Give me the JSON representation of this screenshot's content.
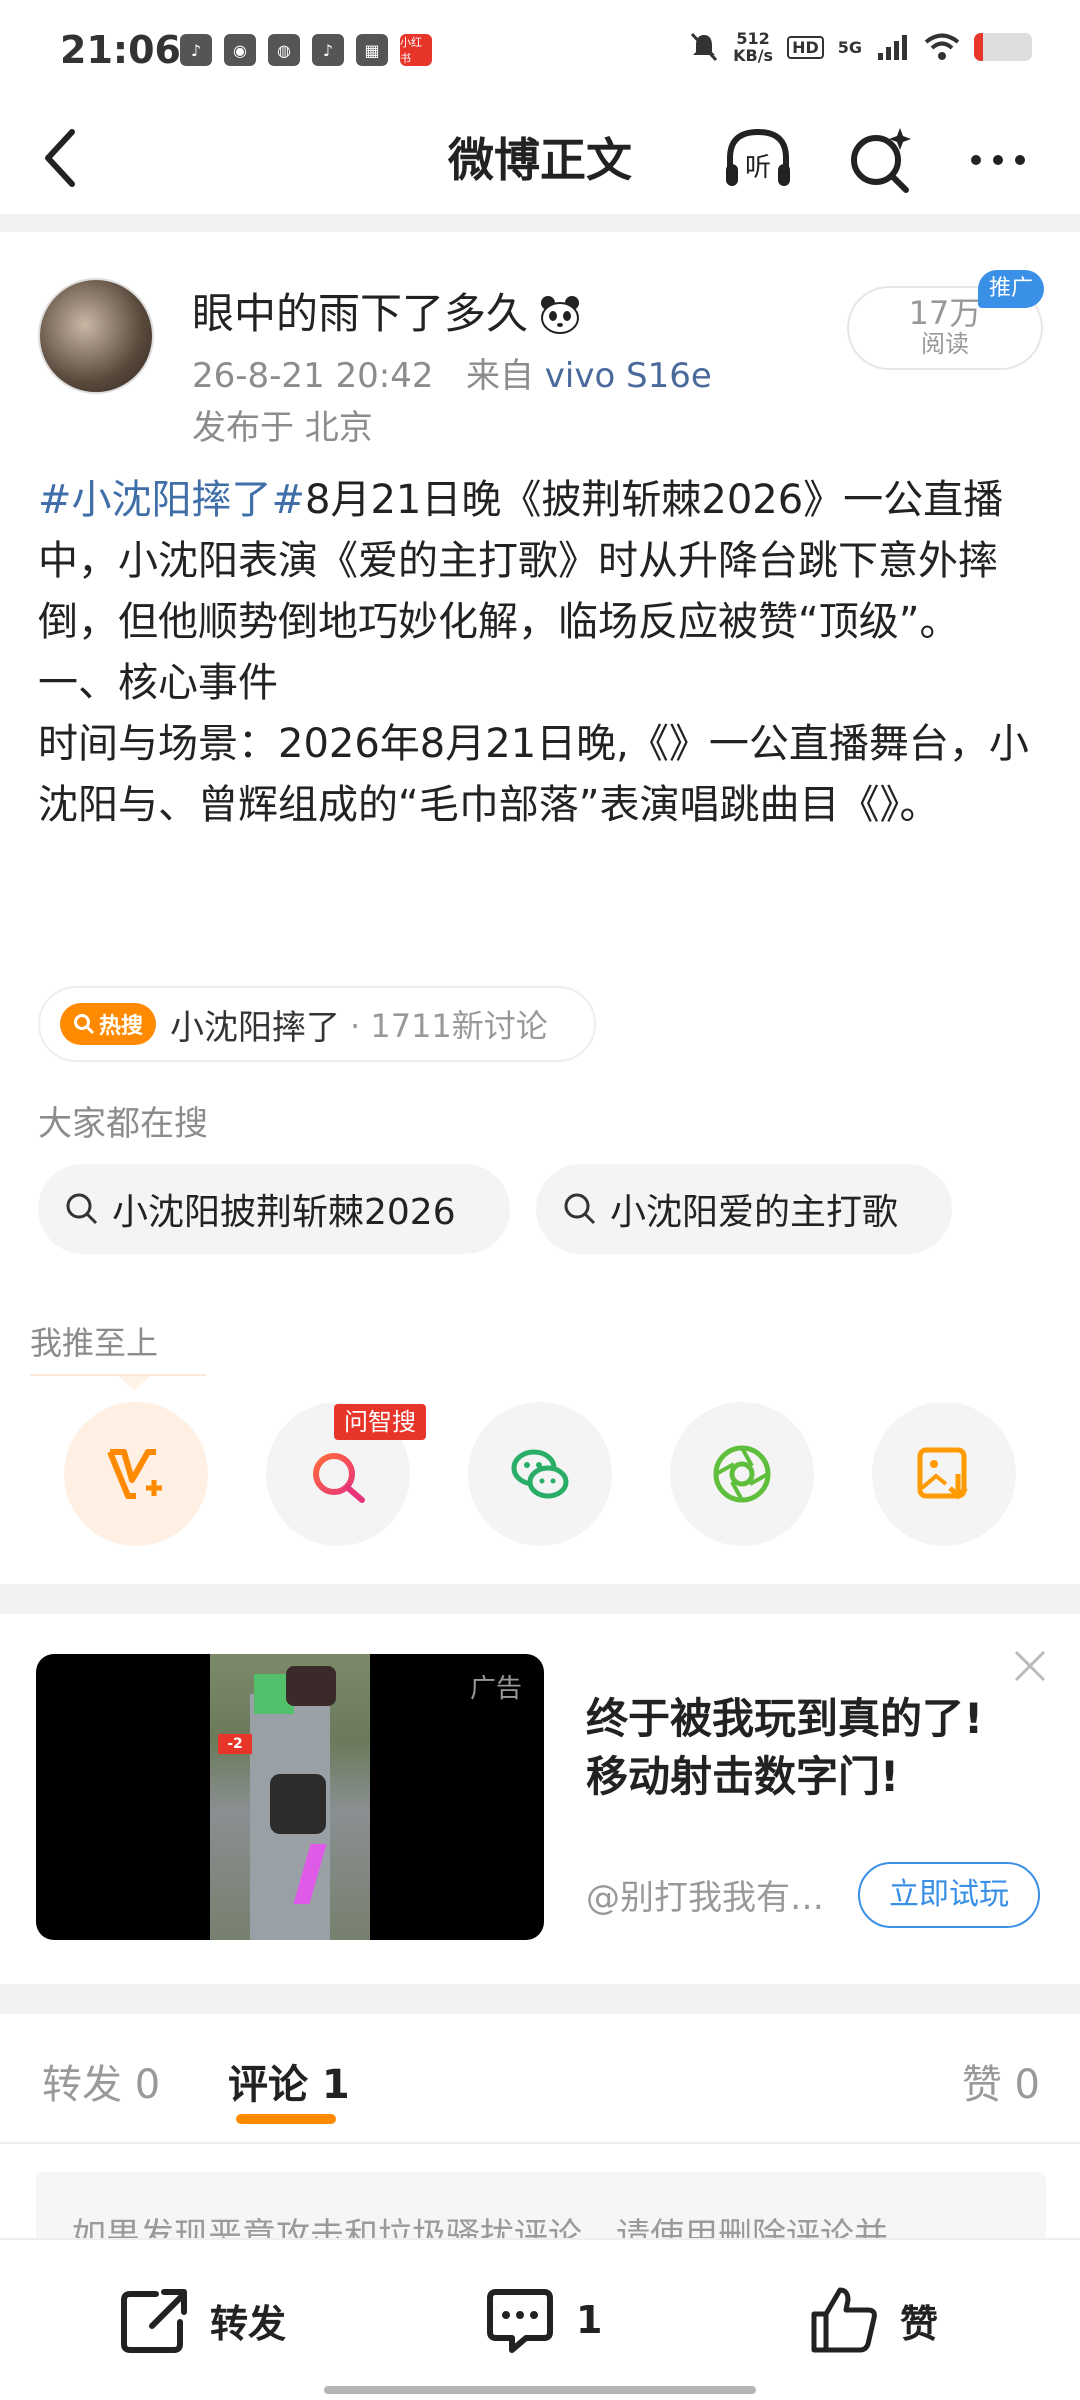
{
  "status_bar": {
    "time": "21:06",
    "app_icons": [
      "douyin-icon",
      "weibo-icon",
      "wechat-icon",
      "douyin-icon",
      "game-icon",
      "xiaohongshu-icon"
    ],
    "xiaohongshu_label": "小红书",
    "net_speed_value": "512",
    "net_speed_unit": "KB/s",
    "hd": "HD",
    "signal": "5G",
    "battery_level": 0.15,
    "battery_color": "#e8352a"
  },
  "nav": {
    "title": "微博正文",
    "listen_label": "听"
  },
  "author": {
    "name": "眼中的雨下了多久",
    "time": "26-8-21 20:42",
    "from_prefix": "来自",
    "device": "vivo S16e",
    "location": "发布于 北京",
    "read_count": "17万",
    "read_label": "阅读",
    "promo": "推广"
  },
  "post": {
    "hashtag": "#小沈阳摔了#",
    "paragraph1": "8月21日晚《披荆斩棘2026》一公直播中，小沈阳表演《爱的主打歌》时从升降台跳下意外摔倒，但他顺势倒地巧妙化解，临场反应被赞“顶级”。",
    "paragraph2": "一、核心事件",
    "paragraph3": "时间与场景：2026年8月21日晚,《》一公直播舞台，小沈阳与、曾辉组成的“毛巾部落”表演唱跳曲目《》。"
  },
  "hot_search": {
    "badge": "热搜",
    "topic": "小沈阳摔了",
    "count": "· 1711新讨论"
  },
  "search_suggest": {
    "title": "大家都在搜",
    "items": [
      "小沈阳披荆斩棘2026",
      "小沈阳爱的主打歌"
    ]
  },
  "share": {
    "title": "我推至上",
    "ask_badge": "问智搜",
    "targets": [
      "v-plus-icon",
      "ask-search-icon",
      "wechat-icon",
      "moments-icon",
      "save-image-icon"
    ]
  },
  "ad": {
    "label": "广告",
    "minus_label": "-2",
    "headline_line1": "终于被我玩到真的了!",
    "headline_line2": "移动射击数字门!",
    "source": "@别打我我有…",
    "cta": "立即试玩"
  },
  "tabs": {
    "repost": "转发 0",
    "comment": "评论 1",
    "like": "赞 0"
  },
  "notice": "如果发现恶意攻击和垃圾骚扰评论，请使用删除评论并",
  "bottom_bar": {
    "repost": "转发",
    "comment_count": "1",
    "like": "赞"
  },
  "colors": {
    "accent_orange": "#ff8a00",
    "link_blue": "#3f6ea8",
    "cta_blue": "#3a8fe6",
    "alert_red": "#e8352a"
  }
}
